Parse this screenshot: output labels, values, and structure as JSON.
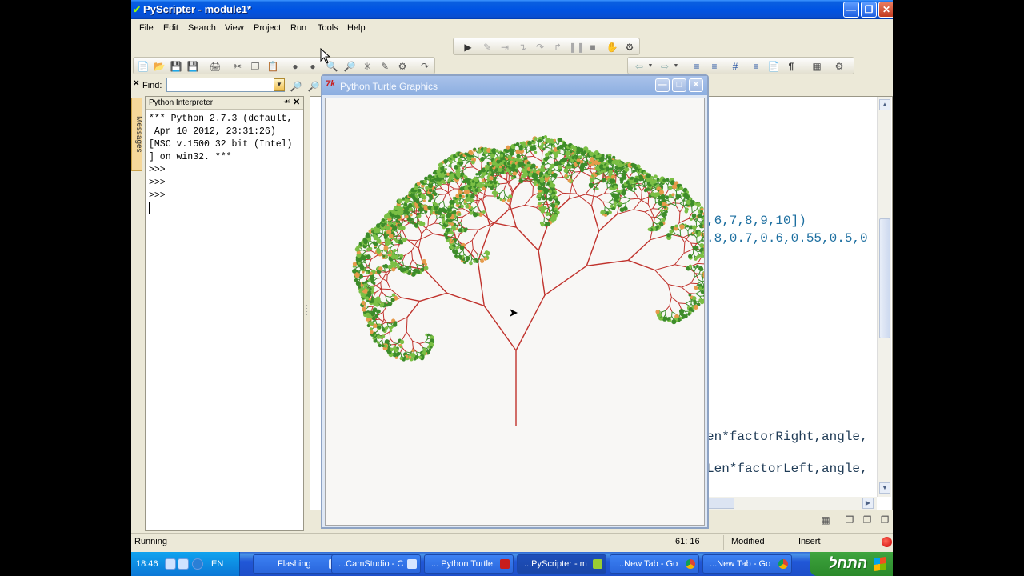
{
  "window": {
    "title": "PyScripter - module1*"
  },
  "menu": [
    "File",
    "Edit",
    "Search",
    "View",
    "Project",
    "Run",
    "Tools",
    "Help"
  ],
  "find": {
    "label": "Find:",
    "value": ""
  },
  "side_tab": {
    "label": "Messages"
  },
  "interpreter": {
    "title": "Python Interpreter",
    "lines": [
      "*** Python 2.7.3 (default,",
      " Apr 10 2012, 23:31:26)",
      "[MSC v.1500 32 bit (Intel)",
      "] on win32. ***",
      ">>>",
      ">>>",
      ">>>"
    ]
  },
  "editor": {
    "visible_code": [
      ",6,7,8,9,10])",
      ".8,0.7,0.6,0.55,0.5,0",
      "en*factorRight,angle,",
      "Len*factorLeft,angle,"
    ]
  },
  "turtle_window": {
    "title": "Python Turtle Graphics",
    "icon_label": "7k",
    "colors": {
      "branch": "#c0322c",
      "leaf_dark": "#3d8c2a",
      "leaf_light": "#7bbf45",
      "leaf_accent": "#e69a4a",
      "arrow": "#000000"
    }
  },
  "status": {
    "state": "Running",
    "position": "61: 16",
    "modified": "Modified",
    "mode": "Insert"
  },
  "taskbar": {
    "clock": "18:46",
    "language": "EN",
    "buttons": [
      "Flashing",
      "...CamStudio - C",
      "... Python Turtle",
      "...PyScripter - m",
      "...New Tab - Go",
      "...New Tab - Go"
    ],
    "start_label": "התחל"
  }
}
